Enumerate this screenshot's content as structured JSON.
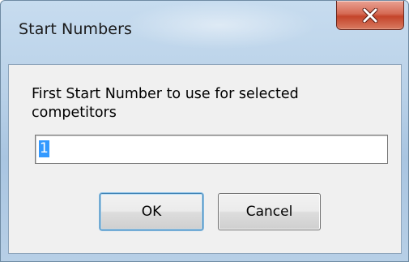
{
  "window": {
    "title": "Start Numbers",
    "close_icon": "close-x-icon"
  },
  "dialog": {
    "prompt": "First Start Number to use for selected competitors",
    "input_value": "1",
    "ok_label": "OK",
    "cancel_label": "Cancel"
  },
  "colors": {
    "frame": "#b9d1e8",
    "client": "#f0f0f0",
    "close_button": "#c4452b",
    "selection": "#3399ff"
  }
}
